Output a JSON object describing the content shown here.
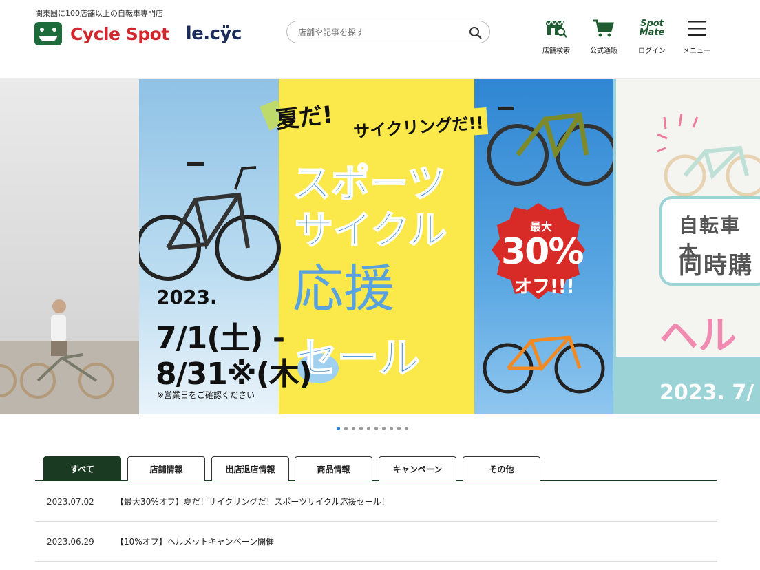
{
  "header": {
    "tagline": "関東圏に100店舗以上の自転車専門店",
    "logo_main": "Cycle Spot",
    "logo_second": "le.cÿc",
    "search_placeholder": "店舗や記事を探す",
    "nav": [
      {
        "label": "店舗検索",
        "icon": "store-search-icon"
      },
      {
        "label": "公式通販",
        "icon": "cart-icon"
      },
      {
        "label": "ログイン",
        "icon": "spotmate-icon",
        "icon_text_1": "Spot",
        "icon_text_2": "Mate"
      },
      {
        "label": "メニュー",
        "icon": "hamburger-icon"
      }
    ]
  },
  "hero": {
    "main": {
      "headline_1": "夏だ!",
      "headline_2": "サイクリングだ!!",
      "big_1": "スポーツ",
      "big_2": "サイクル",
      "big_3": "応援",
      "big_4": "セール",
      "year": "2023.",
      "date_start": "7/1(土) -",
      "date_end": "8/31※(木)",
      "note": "※営業日をご確認ください",
      "badge_small": "最大",
      "badge_big": "30%",
      "badge_off": "オフ!!!"
    },
    "right": {
      "line_1": "自転車本",
      "line_2": "同時購",
      "pink": "ヘルメ",
      "year": "2023. 7/"
    },
    "dots_total": 10,
    "dots_active": 0
  },
  "tabs": [
    {
      "label": "すべて",
      "active": true
    },
    {
      "label": "店舗情報",
      "active": false
    },
    {
      "label": "出店退店情報",
      "active": false
    },
    {
      "label": "商品情報",
      "active": false
    },
    {
      "label": "キャンペーン",
      "active": false
    },
    {
      "label": "その他",
      "active": false
    }
  ],
  "news": [
    {
      "date": "2023.07.02",
      "title": "【最大30%オフ】夏だ！サイクリングだ！スポーツサイクル応援セール！"
    },
    {
      "date": "2023.06.29",
      "title": "【10%オフ】ヘルメットキャンペーン開催"
    }
  ]
}
